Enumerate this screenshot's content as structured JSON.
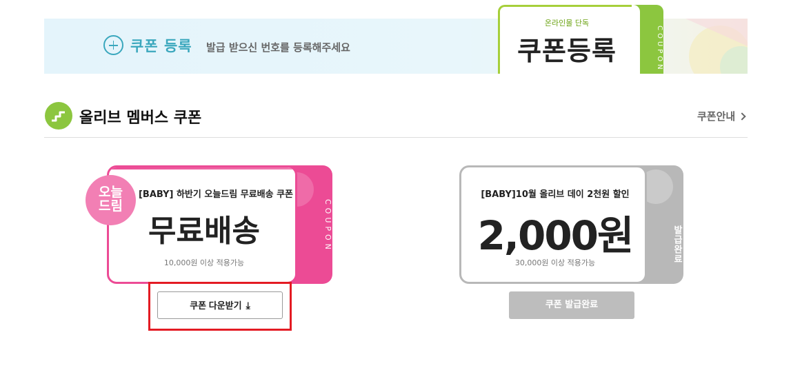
{
  "register": {
    "title": "쿠폰 등록",
    "description": "발급 받으신 번호를 등록해주세요",
    "ticket_subtitle": "온라인몰 단독",
    "ticket_title": "쿠폰등록",
    "ticket_stub_text": "COUPON"
  },
  "section": {
    "title": "올리브 멤버스 쿠폰",
    "guide_link": "쿠폰안내"
  },
  "coupons": [
    {
      "badge": "오늘\n드림",
      "title": "[BABY] 하반기 오늘드림 무료배송 쿠폰",
      "benefit": "무료배송",
      "condition": "10,000원 이상 적용가능",
      "stub_text": "COUPON",
      "button": "쿠폰 다운받기",
      "accent": "#ec4b95"
    },
    {
      "title": "[BABY]10월 올리브 데이 2천원 할인",
      "benefit": "2,000원",
      "condition": "30,000원 이상 적용가능",
      "stub_text": "발급완료",
      "button": "쿠폰 발급완료",
      "accent": "#b8b8b8"
    }
  ],
  "colors": {
    "brand_green": "#8cc63f",
    "register_blue": "#3aa7bd",
    "highlight_red": "#e31b23"
  },
  "icons": {
    "register": "plus-circle-icon",
    "section": "stairs-icon",
    "guide": "chevron-right-icon",
    "download": "download-arrow-icon"
  }
}
